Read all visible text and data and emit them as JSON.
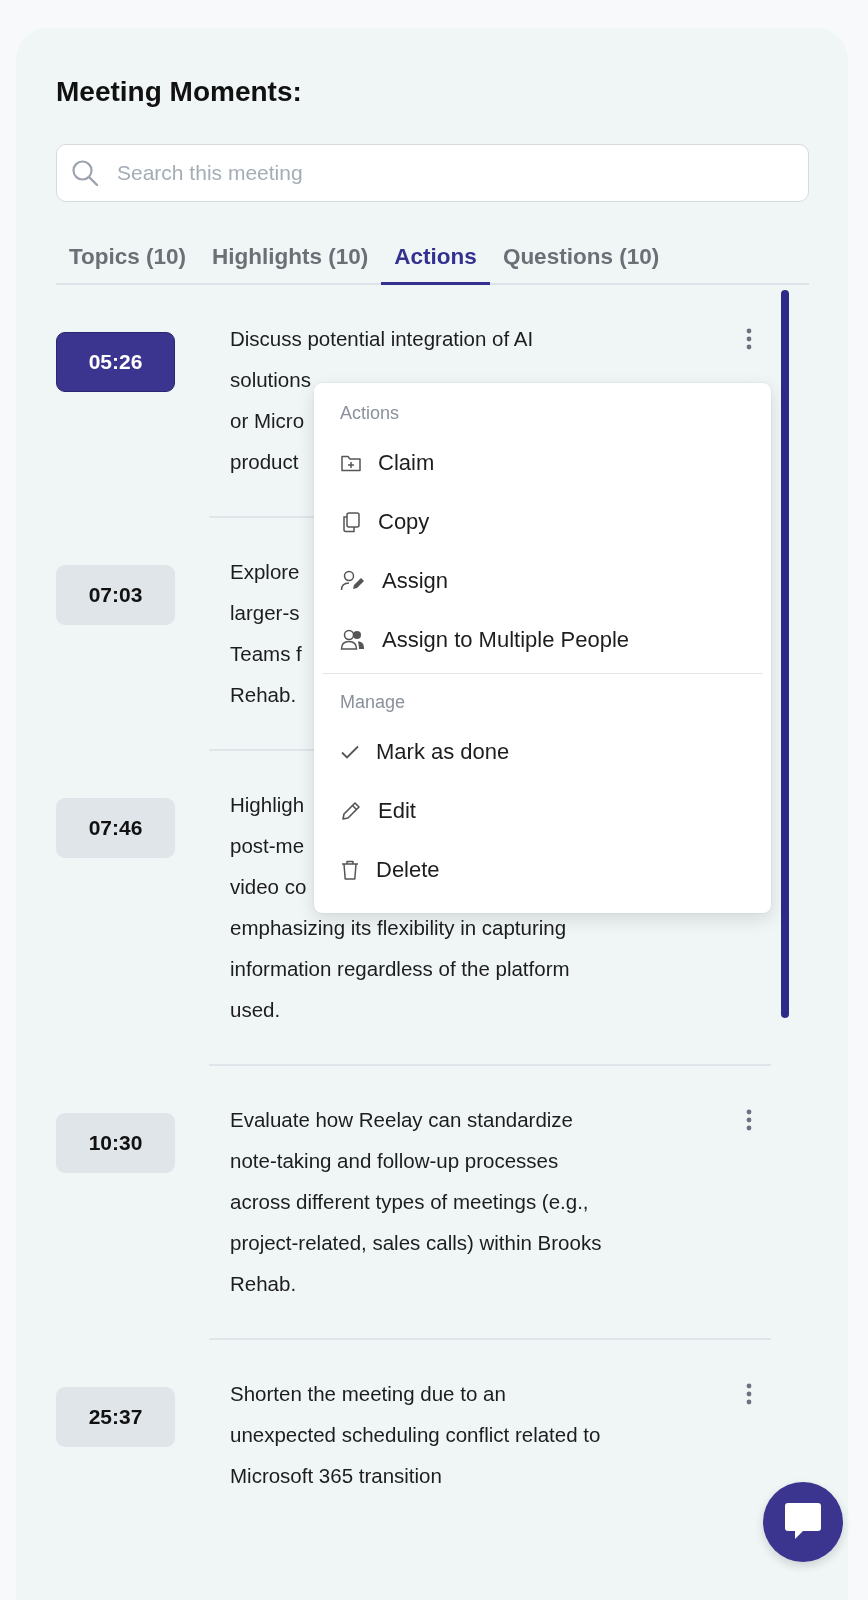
{
  "title": "Meeting Moments:",
  "search": {
    "placeholder": "Search this meeting"
  },
  "tabs": [
    {
      "label": "Topics (10)",
      "selected": false
    },
    {
      "label": "Highlights (10)",
      "selected": false
    },
    {
      "label": "Actions",
      "selected": true
    },
    {
      "label": "Questions (10)",
      "selected": false
    }
  ],
  "items": [
    {
      "time": "05:26",
      "selected": true,
      "text": "Discuss potential integration of AI\nsolutions\nor Micro\nproduct",
      "more_button": true
    },
    {
      "time": "07:03",
      "selected": false,
      "text": "Explore\nlarger-s\nTeams f\nRehab.",
      "more_button": false
    },
    {
      "time": "07:46",
      "selected": false,
      "text": "Highligh\npost-me\nvideo co\nemphasizing its flexibility in capturing\ninformation regardless of the platform\nused.",
      "more_button": false
    },
    {
      "time": "10:30",
      "selected": false,
      "text": "Evaluate how Reelay can standardize\nnote-taking and follow-up processes\nacross different types of meetings (e.g.,\nproject-related, sales calls) within Brooks\nRehab.",
      "more_button": true
    },
    {
      "time": "25:37",
      "selected": false,
      "text": "Shorten the meeting due to an\nunexpected scheduling conflict related to\nMicrosoft 365 transition",
      "more_button": true
    }
  ],
  "menu": {
    "sections": [
      {
        "heading": "Actions",
        "items": [
          {
            "label": "Claim",
            "kind": "claim"
          },
          {
            "label": "Copy",
            "kind": "copy"
          },
          {
            "label": "Assign",
            "kind": "assign"
          },
          {
            "label": "Assign to Multiple People",
            "kind": "assign-many"
          }
        ]
      },
      {
        "heading": "Manage",
        "items": [
          {
            "label": "Mark as done",
            "kind": "done"
          },
          {
            "label": "Edit",
            "kind": "edit"
          },
          {
            "label": "Delete",
            "kind": "delete"
          }
        ]
      }
    ]
  }
}
